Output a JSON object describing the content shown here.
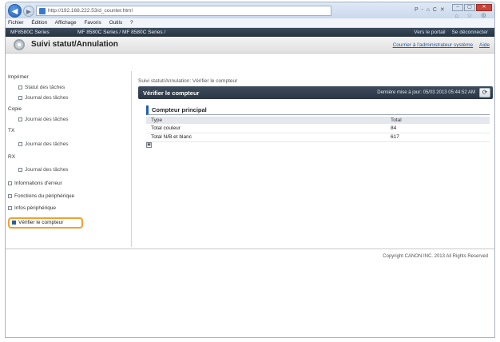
{
  "browser": {
    "address": "http://192.168.222.53/d_counter.html",
    "search_tools": "P - ⌂ C ✕",
    "toolbar_icons": "⌂ ☆ ⚙",
    "menu": [
      "Fichier",
      "Édition",
      "Affichage",
      "Favoris",
      "Outils",
      "?"
    ]
  },
  "device_bar": {
    "id": "MF8580C Series",
    "path": "MF 8580C Series / MF 8580C Series /",
    "links": [
      "Vers le portail",
      "Se déconnecter"
    ]
  },
  "page": {
    "title": "Suivi statut/Annulation",
    "top_links": [
      "Courrier à l'administrateur système",
      "Aide"
    ]
  },
  "sidebar": {
    "sections": [
      {
        "label": "Imprimer"
      },
      {
        "label": "Statut des tâches",
        "sub": true
      },
      {
        "label": "Journal des tâches",
        "sub": true
      },
      {
        "label": "Copie"
      },
      {
        "label": "Journal des tâches",
        "sub": true
      },
      {
        "label": "TX"
      },
      {
        "label": "Journal des tâches",
        "sub": true
      },
      {
        "label": "RX"
      },
      {
        "label": "Journal des tâches",
        "sub": true
      },
      {
        "label": "Informations d'erreur",
        "item": true
      },
      {
        "label": "Fonctions du périphérique",
        "item": true
      },
      {
        "label": "Infos périphérique",
        "item": true
      }
    ],
    "active": "Vérifier le compteur"
  },
  "main": {
    "breadcrumb": "Suivi statut/Annulation: Vérifier le compteur",
    "section_title": "Vérifier le compteur",
    "last_update": "Dernière mise à jour: 05/03 2013 05:44:52 AM",
    "panel_title": "Compteur principal",
    "table": {
      "headers": [
        "Type",
        "Total"
      ],
      "rows": [
        [
          "Total couleur",
          "84"
        ],
        [
          "Total N/B et blanc",
          "617"
        ]
      ]
    }
  },
  "footer": {
    "copyright": "Copyright CANON INC. 2013 All Rights Reserved"
  }
}
